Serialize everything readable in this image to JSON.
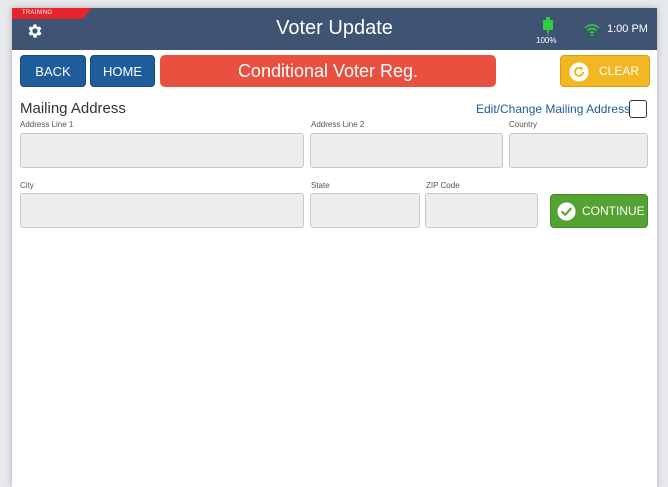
{
  "header": {
    "training_label": "TRAINING",
    "title": "Voter Update",
    "battery": "100%",
    "time": "1:00 PM"
  },
  "toolbar": {
    "back_label": "BACK",
    "home_label": "HOME",
    "banner_text": "Conditional Voter Reg.",
    "clear_label": "CLEAR"
  },
  "form": {
    "section_title": "Mailing Address",
    "edit_link": "Edit/Change Mailing Address",
    "labels": {
      "address1": "Address Line 1",
      "address2": "Address Line 2",
      "country": "Country",
      "city": "City",
      "state": "State",
      "zip": "ZIP Code"
    },
    "values": {
      "address1": "",
      "address2": "",
      "country": "",
      "city": "",
      "state": "",
      "zip": ""
    },
    "continue_label": "CONTINUE"
  },
  "icons": {
    "settings": "gear-icon",
    "battery": "battery-icon",
    "wifi": "wifi-icon",
    "clear": "refresh-icon",
    "continue": "check-circle-icon"
  },
  "colors": {
    "titlebar": "#3f5473",
    "primary_button": "#1f5c9c",
    "banner": "#e8503f",
    "clear_button": "#f2b722",
    "continue_button": "#54a332",
    "training_ribbon": "#e5242b",
    "status_green": "#2ecc40"
  }
}
